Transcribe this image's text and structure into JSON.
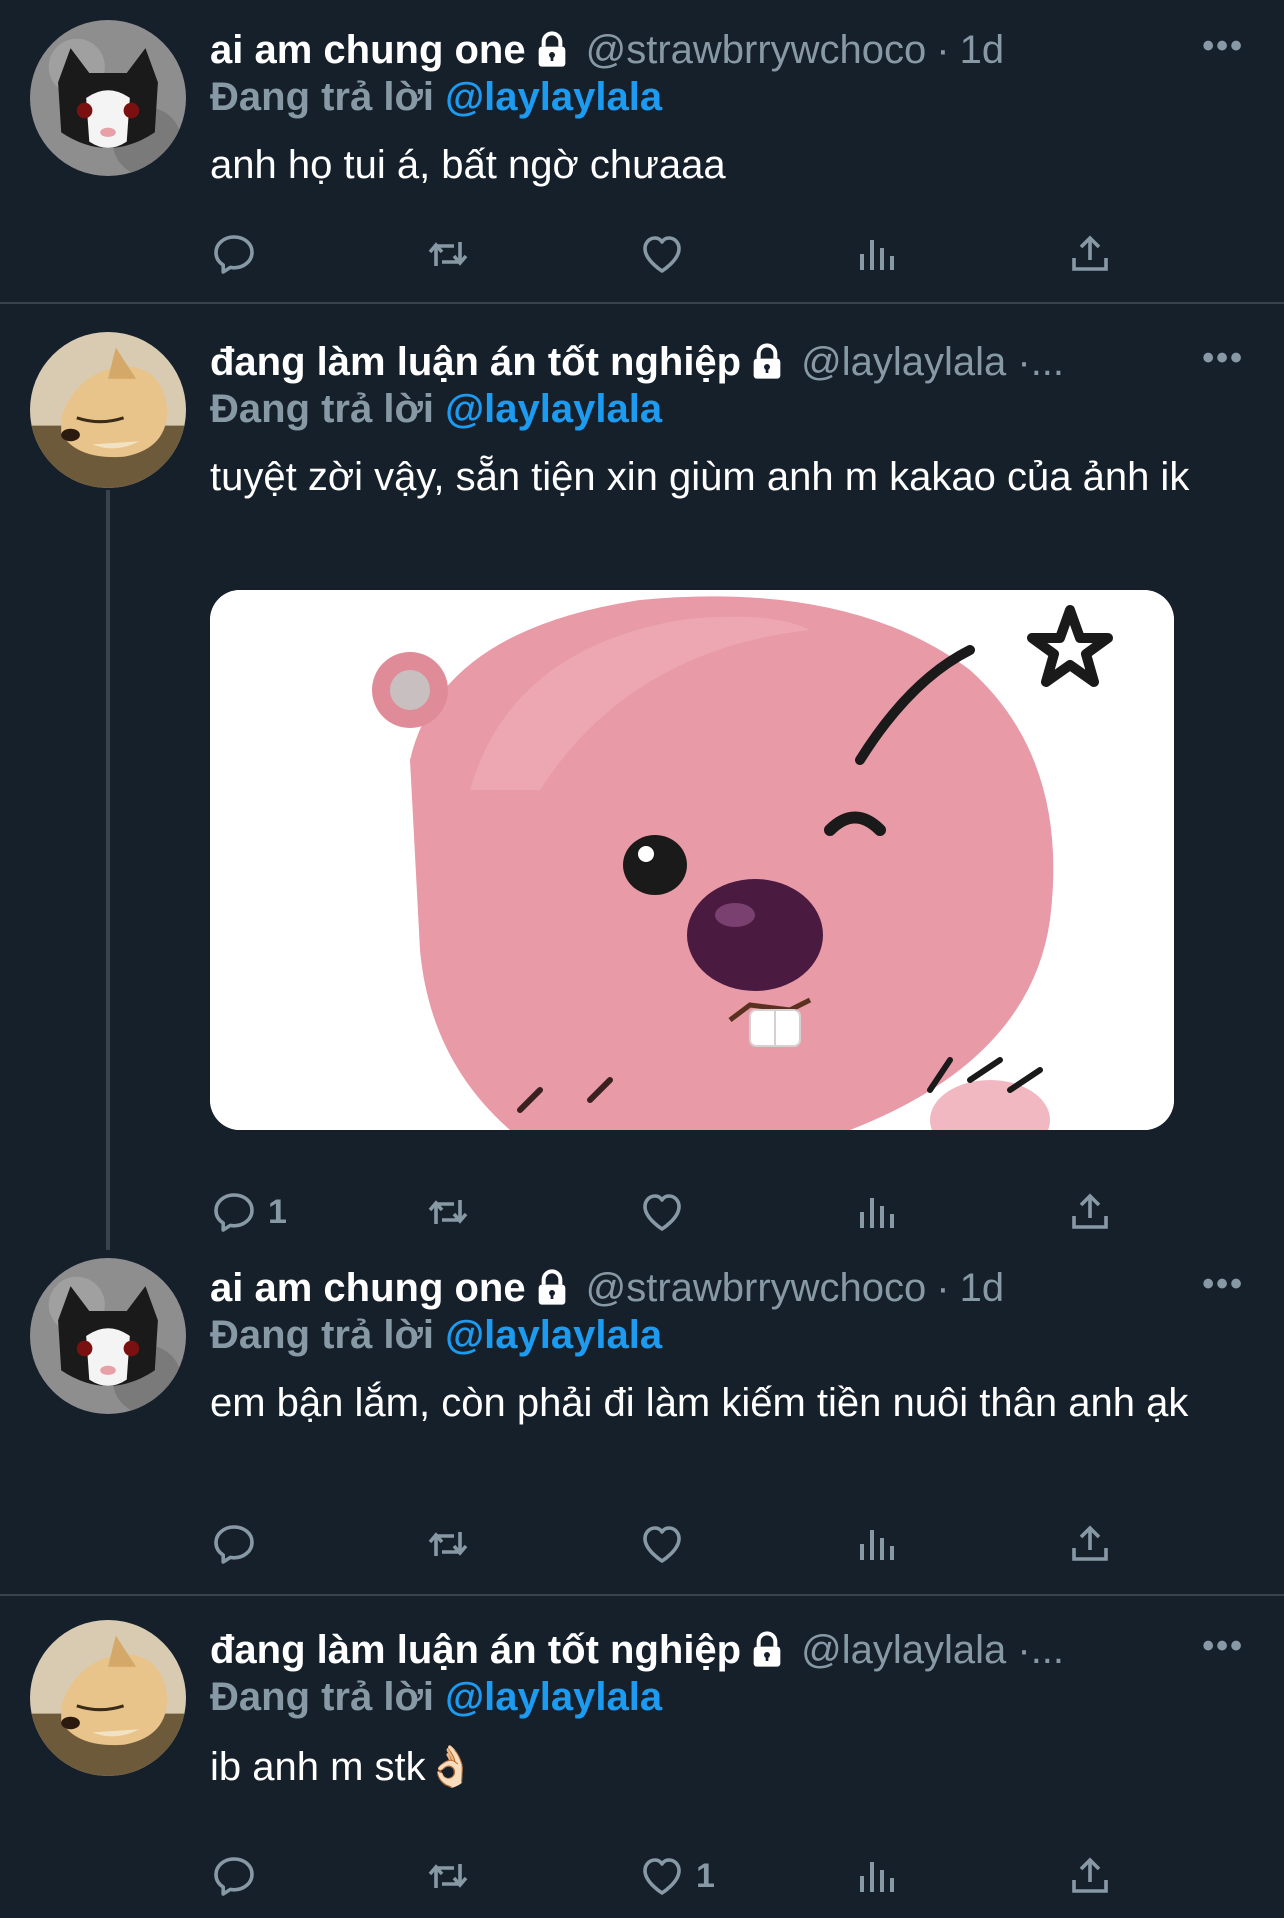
{
  "tweets": [
    {
      "name": "ai am chung one",
      "handle": "@strawbrrywchoco",
      "sep": "·",
      "time": "1d",
      "more": "•••",
      "reply_label": "Đang trả lời",
      "reply_mention": "@laylaylala",
      "text": "anh họ tui á, bất ngờ chưaaa",
      "avatar": "cat-avatar",
      "counts": {
        "reply": "",
        "retweet": "",
        "like": ""
      }
    },
    {
      "name": "đang làm luận án tốt nghiệp",
      "handle": "@laylaylala ·...",
      "sep": "",
      "time": "",
      "more": "•••",
      "reply_label": "Đang trả lời",
      "reply_mention": "@laylaylala",
      "text": "tuyệt zời vậy, sẵn tiện xin giùm anh m kakao của ảnh ik",
      "avatar": "dog-avatar",
      "media": "pink-beaver-sticker",
      "counts": {
        "reply": "1",
        "retweet": "",
        "like": ""
      }
    },
    {
      "name": "ai am chung one",
      "handle": "@strawbrrywchoco",
      "sep": "·",
      "time": "1d",
      "more": "•••",
      "reply_label": "Đang trả lời",
      "reply_mention": "@laylaylala",
      "text": "em bận lắm, còn phải đi làm kiếm tiền nuôi thân anh ạk",
      "avatar": "cat-avatar",
      "counts": {
        "reply": "",
        "retweet": "",
        "like": ""
      }
    },
    {
      "name": "đang làm luận án tốt nghiệp",
      "handle": "@laylaylala ·...",
      "sep": "",
      "time": "",
      "more": "•••",
      "reply_label": "Đang trả lời",
      "reply_mention": "@laylaylala",
      "text": "ib anh m stk👌🏻",
      "avatar": "dog-avatar",
      "counts": {
        "reply": "",
        "retweet": "",
        "like": "1"
      }
    }
  ],
  "colors": {
    "background": "#15202b",
    "muted": "#8899a6",
    "mention": "#1d9bf0",
    "divider": "#38444d"
  }
}
